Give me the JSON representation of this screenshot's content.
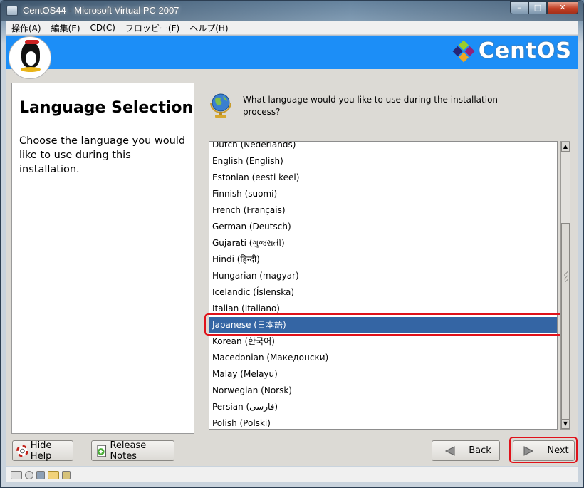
{
  "window": {
    "title": "CentOS44 - Microsoft Virtual PC 2007"
  },
  "window_controls": {
    "minimize": "–",
    "maximize": "□",
    "close": "✕"
  },
  "menu": [
    "操作(A)",
    "編集(E)",
    "CD(C)",
    "フロッピー(F)",
    "ヘルプ(H)"
  ],
  "banner": {
    "brand": "CentOS"
  },
  "help": {
    "title": "Language Selection",
    "body": "Choose the language you would like to use during this installation."
  },
  "question": "What language would you like to use during the installation process?",
  "languages": [
    "Dutch (Nederlands)",
    "English (English)",
    "Estonian (eesti keel)",
    "Finnish (suomi)",
    "French (Français)",
    "German (Deutsch)",
    "Gujarati (ગુજરાતી)",
    "Hindi (हिन्दी)",
    "Hungarian (magyar)",
    "Icelandic (Íslenska)",
    "Italian (Italiano)",
    "Japanese (日本語)",
    "Korean (한국어)",
    "Macedonian (Македонски)",
    "Malay (Melayu)",
    "Norwegian (Norsk)",
    "Persian (فارسی)",
    "Polish (Polski)"
  ],
  "selected_language": "Japanese (日本語)",
  "buttons": {
    "hide_help": "Hide Help",
    "release_notes": "Release Notes",
    "back": "Back",
    "next": "Next"
  },
  "colors": {
    "banner": "#1c8ef7",
    "selection": "#3465a4",
    "annotation": "#e0121a"
  },
  "status_icons": [
    "hard-disk-icon",
    "cd-icon",
    "floppy-icon",
    "folder-icon",
    "network-icon"
  ]
}
